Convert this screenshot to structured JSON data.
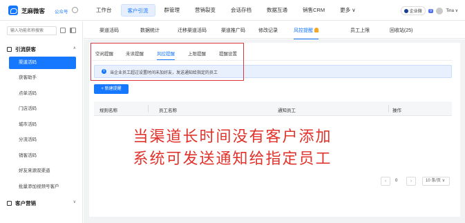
{
  "header": {
    "brand": "芝麻微客",
    "account_type": "公众号",
    "nav": [
      "工作台",
      "客户引流",
      "群管理",
      "营销裂变",
      "会话存档",
      "数据互通",
      "销售CRM",
      "更多 ∨"
    ],
    "nav_active_index": 1,
    "enterprise_badge": "企业微",
    "verified_badge": "V",
    "user_name": "Tina ∨"
  },
  "sidebar": {
    "search_placeholder": "输入功能名称搜索",
    "group1_title": "引流获客",
    "group1_chevron": "∧",
    "items": [
      "渠道活码",
      "获客助手",
      "点单活码",
      "门店活码",
      "城市活码",
      "分流活码",
      "销客活码",
      "好友来源双渠道",
      "批量添加视频号客户"
    ],
    "active_index": 0,
    "group2_title": "客户营销",
    "group2_chevron": "∨"
  },
  "tabs": {
    "items": [
      "渠道活码",
      "数据统计",
      "迁移渠道活码",
      "渠道推广码",
      "修改记录",
      "风控提醒",
      "员工上限",
      "回收站(25)"
    ],
    "active_index": 5
  },
  "subtabs": {
    "items": [
      "空闲提醒",
      "未读提醒",
      "风控提醒",
      "上限提醒",
      "提醒设置"
    ],
    "active_index": 2
  },
  "info_text": "当企业员工超过设置时间未加好友，发送通知给指定的员工",
  "add_button": "+ 新建提醒",
  "table": {
    "columns": [
      "规则名称",
      "员工名称",
      "通知员工",
      "操作"
    ]
  },
  "overlay": {
    "line1": "当渠道长时间没有客户添加",
    "line2": "系统可发送通知给指定员工"
  },
  "pagination": {
    "prev": "‹",
    "page": "0",
    "next": "›",
    "page_size": "10 条/页 ∨"
  },
  "colors": {
    "accent": "#1677ff",
    "highlight_border": "#d9363e",
    "overlay_text": "#e0322a"
  }
}
